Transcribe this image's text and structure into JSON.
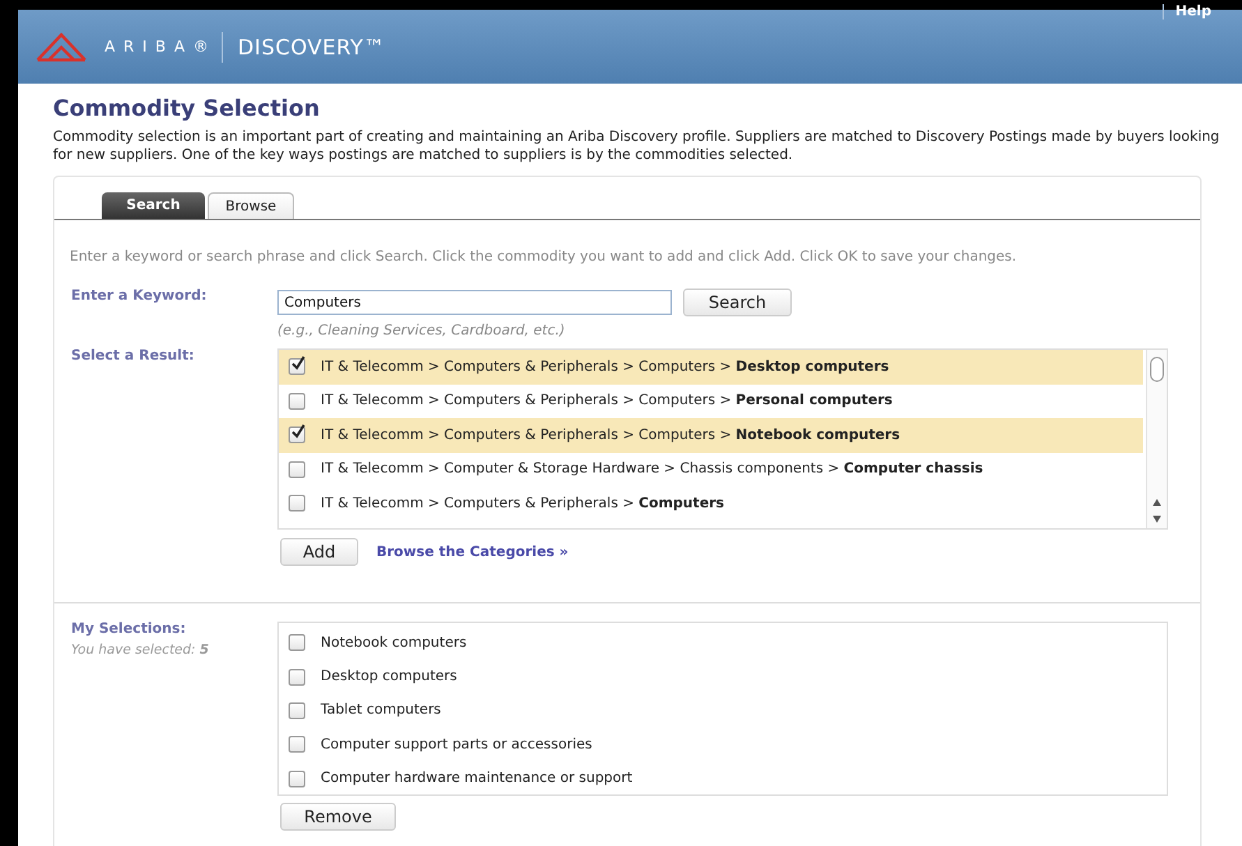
{
  "header": {
    "brand": "ARIBA®",
    "product": "DISCOVERY™",
    "help_link": "Help"
  },
  "page": {
    "title": "Commodity Selection",
    "description": "Commodity selection is an important part of creating and maintaining an Ariba Discovery profile. Suppliers are matched to Discovery Postings made by buyers looking for new suppliers. One of the key ways postings are matched to suppliers is by the commodities selected."
  },
  "tabs": [
    {
      "label": "Search",
      "selected": true
    },
    {
      "label": "Browse",
      "selected": false
    }
  ],
  "instructions": "Enter a keyword or search phrase and click Search. Click the commodity you want to add and click Add. Click OK to save your changes.",
  "keyword": {
    "label": "Enter a Keyword:",
    "value": "Computers",
    "hint": "(e.g., Cleaning Services, Cardboard, etc.)",
    "button": "Search"
  },
  "results": {
    "label": "Select a Result:",
    "rows": [
      {
        "text": "IT & Telecomm > Computers & Peripherals > Computers > **Desktop computers**",
        "checked": true
      },
      {
        "text": "IT & Telecomm > Computers & Peripherals > Computers > **Personal computers**",
        "checked": false
      },
      {
        "text": "IT & Telecomm > Computers & Peripherals > Computers > **Notebook computers**",
        "checked": true
      },
      {
        "text": "IT & Telecomm > Computer & Storage Hardware > Chassis components > **Computer chassis**",
        "checked": false
      },
      {
        "text": "IT & Telecomm > Computers & Peripherals > **Computers**",
        "checked": false
      }
    ],
    "add_button": "Add",
    "browse_link": "Browse the Categories »"
  },
  "selections": {
    "label": "My Selections:",
    "count_text": "You have selected: **5**",
    "items": [
      {
        "label": "Notebook computers",
        "checked": false
      },
      {
        "label": "Desktop computers",
        "checked": false
      },
      {
        "label": "Tablet computers",
        "checked": false
      },
      {
        "label": "Computer support parts or accessories",
        "checked": false
      },
      {
        "label": "Computer hardware maintenance or support",
        "checked": false
      }
    ],
    "remove_button": "Remove"
  }
}
